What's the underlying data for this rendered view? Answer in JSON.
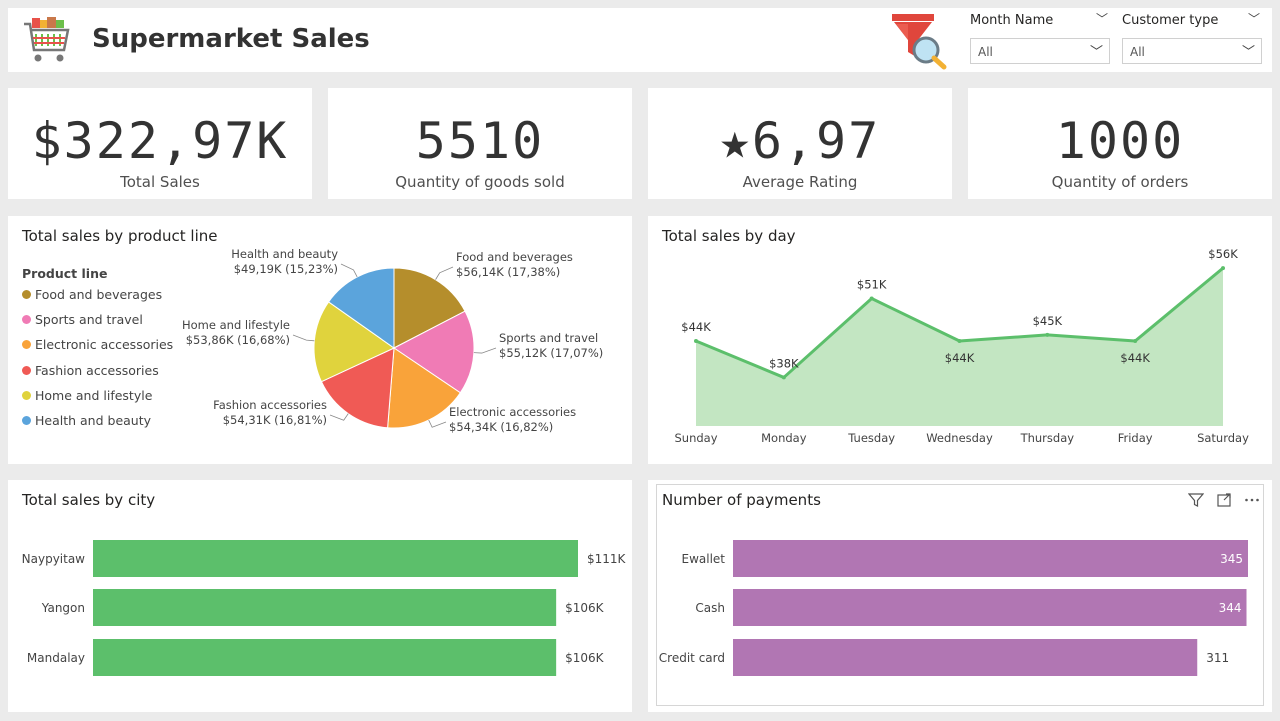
{
  "header": {
    "title": "Supermarket Sales",
    "logo_icon": "shopping-cart-icon",
    "filter_icon": "funnel-search-icon",
    "slicers": [
      {
        "label": "Month Name",
        "value": "All"
      },
      {
        "label": "Customer type",
        "value": "All"
      }
    ]
  },
  "kpis": [
    {
      "value": "$322,97K",
      "caption": "Total Sales"
    },
    {
      "value": "5510",
      "caption": "Quantity of goods sold"
    },
    {
      "value": "★6,97",
      "caption": "Average Rating"
    },
    {
      "value": "1000",
      "caption": "Quantity of orders"
    }
  ],
  "product_line": {
    "title": "Total sales by product line",
    "legend_title": "Product line",
    "items": [
      {
        "name": "Food and beverages",
        "color": "#b58e2c",
        "label": "$56,14K (17,38%)"
      },
      {
        "name": "Sports and travel",
        "color": "#f07bb5",
        "label": "$55,12K (17,07%)"
      },
      {
        "name": "Electronic accessories",
        "color": "#f9a33a",
        "label": "$54,34K (16,82%)"
      },
      {
        "name": "Fashion accessories",
        "color": "#f05a55",
        "label": "$54,31K (16,81%)"
      },
      {
        "name": "Home and lifestyle",
        "color": "#e0d33d",
        "label": "$53,86K (16,68%)"
      },
      {
        "name": "Health and beauty",
        "color": "#5ba4dc",
        "label": "$49,19K (15,23%)"
      }
    ]
  },
  "by_day": {
    "title": "Total sales by day",
    "line_color": "#5cbf6b",
    "fill_color": "#c3e6c2"
  },
  "by_city": {
    "title": "Total sales by city",
    "bar_color": "#5cbf6b"
  },
  "payments": {
    "title": "Number of payments",
    "bar_color": "#b176b3",
    "toolbar": {
      "filter_icon": "filter-icon",
      "focus_icon": "focus-mode-icon",
      "more_icon": "more-options-icon"
    }
  },
  "chart_data": [
    {
      "type": "pie",
      "title": "Total sales by product line",
      "categories": [
        "Food and beverages",
        "Sports and travel",
        "Electronic accessories",
        "Fashion accessories",
        "Home and lifestyle",
        "Health and beauty"
      ],
      "values": [
        56.14,
        55.12,
        54.34,
        54.31,
        53.86,
        49.19
      ],
      "percentages": [
        17.38,
        17.07,
        16.82,
        16.81,
        16.68,
        15.23
      ],
      "unit": "$K",
      "legend": "left"
    },
    {
      "type": "area",
      "title": "Total sales by day",
      "categories": [
        "Sunday",
        "Monday",
        "Tuesday",
        "Wednesday",
        "Thursday",
        "Friday",
        "Saturday"
      ],
      "values": [
        44,
        38,
        51,
        44,
        45,
        44,
        56
      ],
      "labels": [
        "$44K",
        "$38K",
        "$51K",
        "$44K",
        "$45K",
        "$44K",
        "$56K"
      ],
      "ylim": [
        30,
        58
      ],
      "grid": false
    },
    {
      "type": "bar",
      "orientation": "horizontal",
      "title": "Total sales by city",
      "categories": [
        "Naypyitaw",
        "Yangon",
        "Mandalay"
      ],
      "values": [
        111,
        106,
        106
      ],
      "labels": [
        "$111K",
        "$106K",
        "$106K"
      ],
      "xlim": [
        0,
        111
      ]
    },
    {
      "type": "bar",
      "orientation": "horizontal",
      "title": "Number of payments",
      "categories": [
        "Ewallet",
        "Cash",
        "Credit card"
      ],
      "values": [
        345,
        344,
        311
      ],
      "labels": [
        "345",
        "344",
        "311"
      ],
      "xlim": [
        0,
        345
      ]
    }
  ]
}
